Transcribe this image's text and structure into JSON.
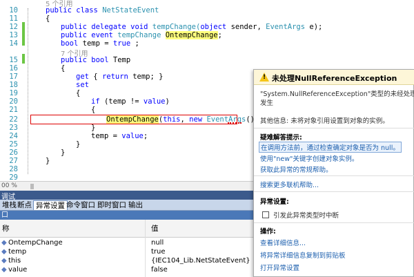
{
  "editor": {
    "line_numbers": [
      "10",
      "11",
      "12",
      "13",
      "14",
      "15",
      "16",
      "17",
      "18",
      "19",
      "20",
      "21",
      "22",
      "23",
      "24",
      "25",
      "26",
      "27",
      "28",
      "29"
    ],
    "ref_top": "5 个引用",
    "ref_mid": "7 个引用",
    "lines": {
      "l10_kw": "public class ",
      "l10_ty": "NetStateEvent",
      "l11": "{",
      "l12_kw": "public delegate void ",
      "l12_name": "tempChange(",
      "l12_kw2": "object",
      "l12_rest": " sender, ",
      "l12_ty": "EventArgs",
      "l12_end": " e);",
      "l13_kw": "public event ",
      "l13_ty": "tempChange",
      "l13_sp": " ",
      "l13_hl": "OntempChange",
      "l13_end": ";",
      "l14_kw": "bool",
      "l14_mid": " temp = ",
      "l14_kw2": "true",
      "l14_end": " ;",
      "l15_kw": "public bool",
      "l15_end": " Temp",
      "l16": "{",
      "l17_kw": "get",
      "l17_mid": " { ",
      "l17_kw2": "return",
      "l17_end": " temp; }",
      "l18_kw": "set",
      "l19": "{",
      "l20_kw": "if",
      "l20_mid": " (temp != ",
      "l20_kw2": "value",
      "l20_end": ")",
      "l21": "{",
      "l22_hl": "OntempChange",
      "l22_mid": "(",
      "l22_kw": "this",
      "l22_mid2": ", ",
      "l22_kw2": "new",
      "l22_sp": " ",
      "l22_ty": "EventArgs",
      "l22_end": "());",
      "l23": "}",
      "l24_mid": "temp = ",
      "l24_kw": "value",
      "l24_end": ";",
      "l25": "}",
      "l26": "}",
      "l27": "}"
    }
  },
  "zoom": "00 %",
  "panel_title": "调试",
  "tabs": [
    "堆栈",
    "断点",
    "异常设置",
    "命令窗口",
    "即时窗口",
    "输出"
  ],
  "active_tab": "异常设置",
  "locals_window_title": "口",
  "grid": {
    "headers": [
      "称",
      "值"
    ],
    "rows": [
      {
        "name": "OntempChange",
        "value": "null"
      },
      {
        "name": "temp",
        "value": "true"
      },
      {
        "name": "this",
        "value": "{IEC104_Lib.NetStateEvent}"
      },
      {
        "name": "value",
        "value": "false"
      }
    ]
  },
  "exception_popup": {
    "title": "未处理NullReferenceException",
    "message": "\"System.NullReferenceException\"类型的未经处理的异常在...发生",
    "message_line1": "\"System.NullReferenceException\"类型的未经处理的异",
    "message_line2": "发生",
    "other_info": "其他信息: 未将对象引用设置到对象的实例。",
    "tips_heading": "疑难解答提示:",
    "tips": [
      "在调用方法前，通过检查确定对象是否为 null。",
      "使用\"new\"关键字创建对象实例。",
      "获取此异常的常规帮助。"
    ],
    "search_link": "搜索更多联机帮助...",
    "exception_settings_heading": "异常设置:",
    "break_checkbox_label": "引发此异常类型时中断",
    "actions_heading": "操作:",
    "actions": [
      "查看详细信息...",
      "将异常详细信息复制到剪贴板",
      "打开异常设置"
    ]
  },
  "colors": {
    "keyword": "#0000ff",
    "type": "#2b91af",
    "highlight": "#ffff7d",
    "error": "#dd0000",
    "link": "#1c5fae",
    "panel_bar": "#3b5a8c"
  }
}
